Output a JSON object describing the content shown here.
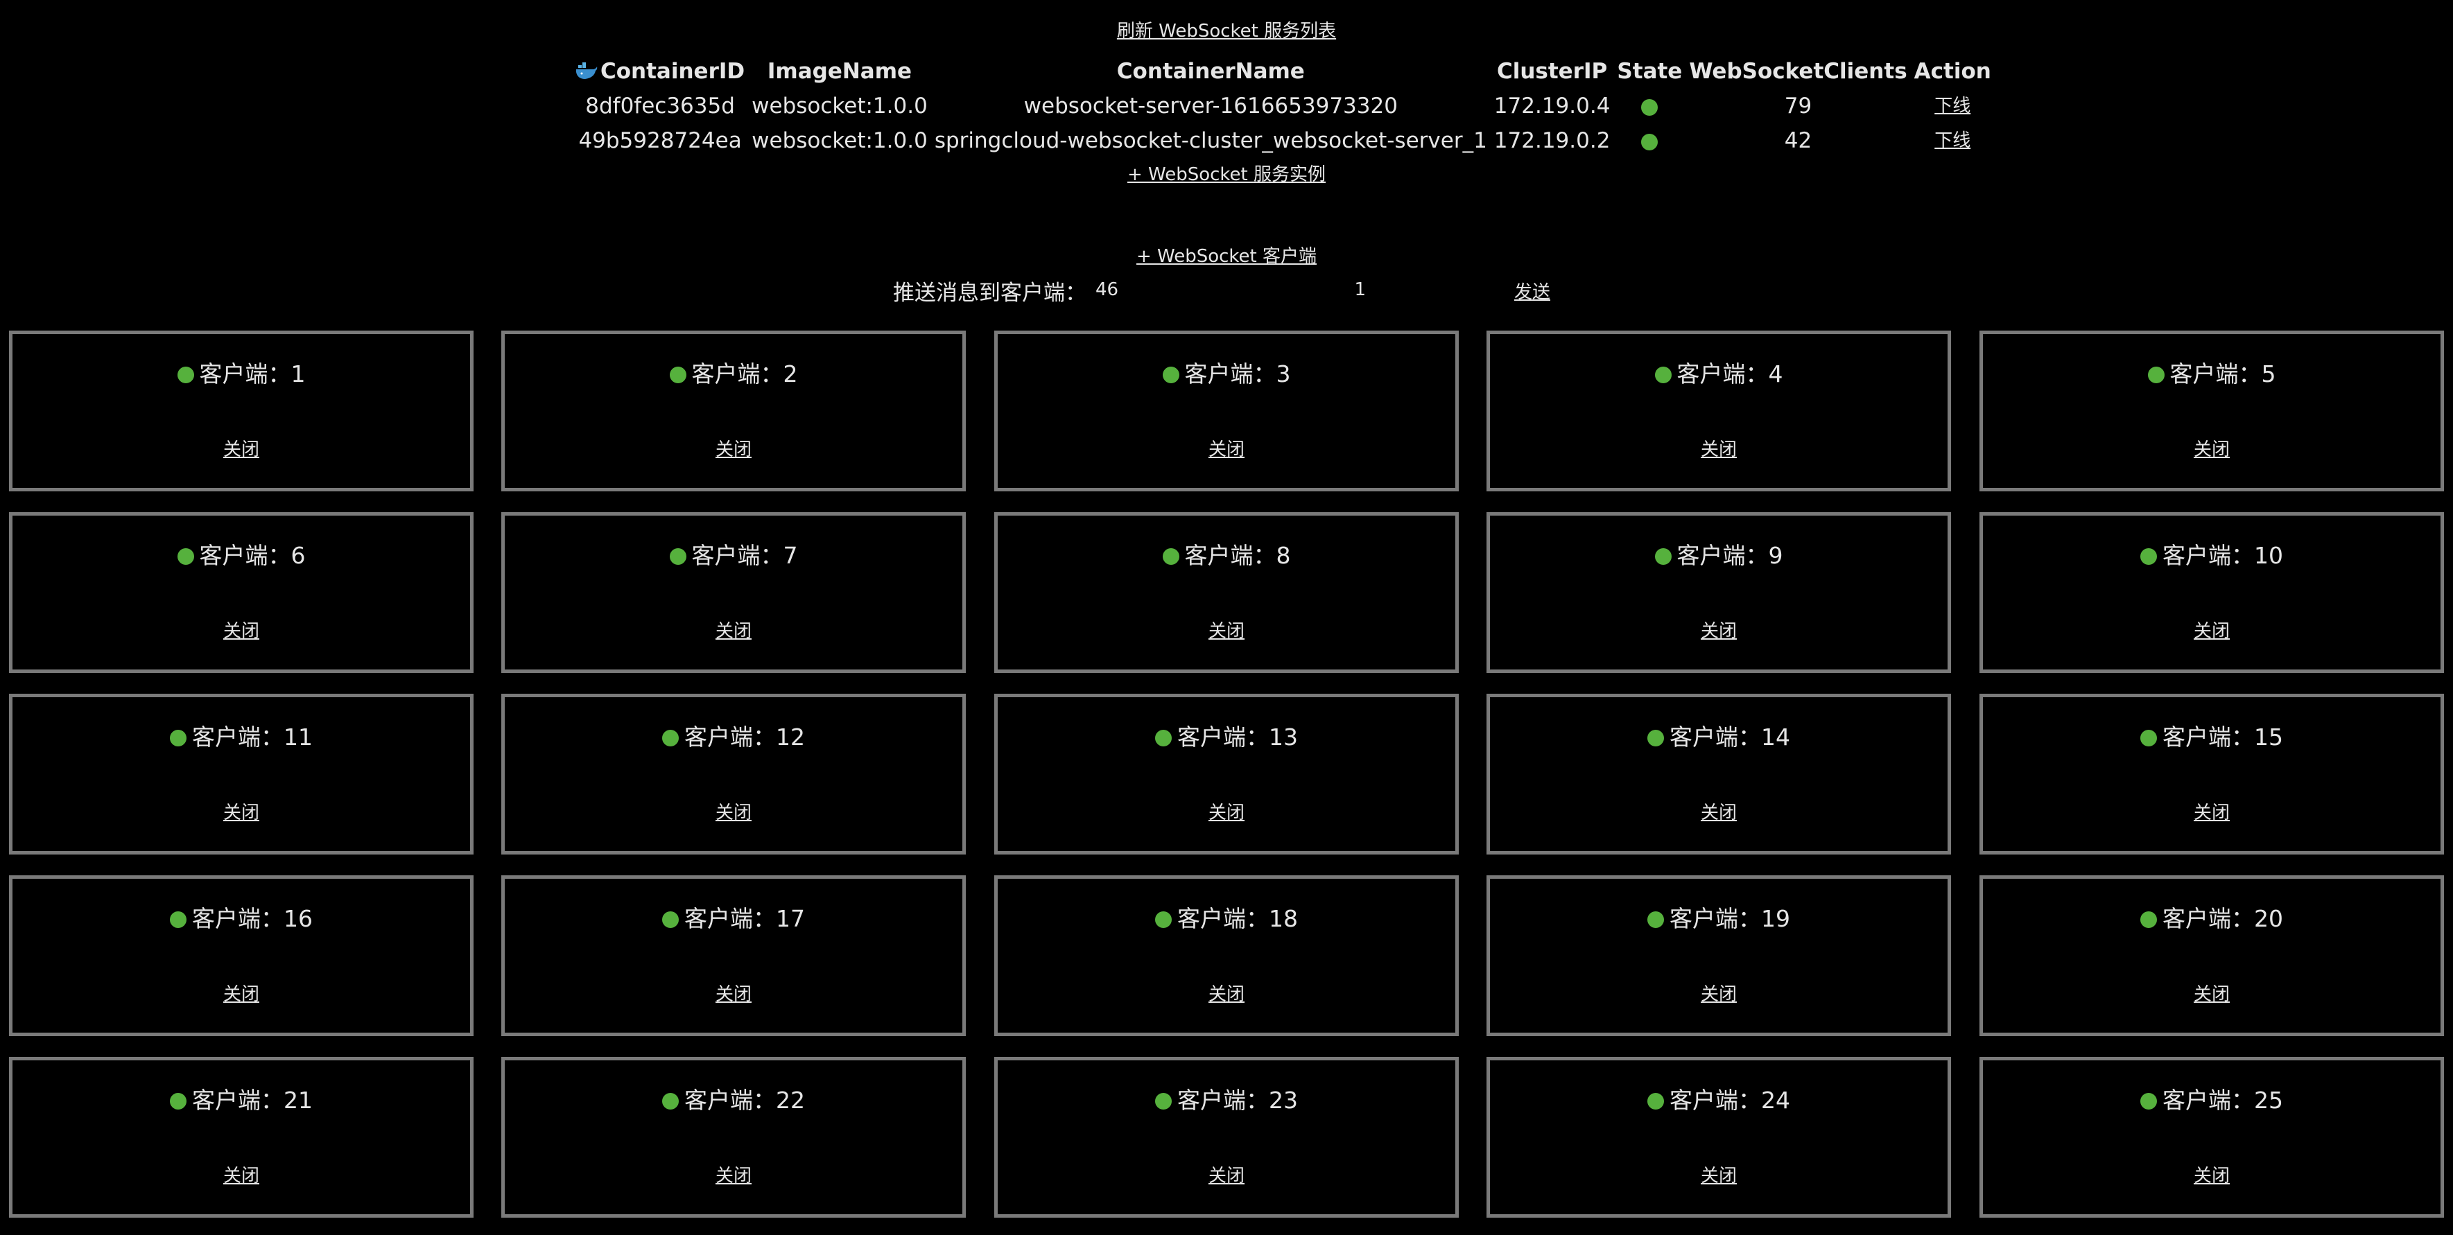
{
  "header": {
    "refresh_link": "刷新 WebSocket 服务列表",
    "add_instance_link": "+ WebSocket 服务实例",
    "add_client_link": "+ WebSocket 客户端"
  },
  "services": {
    "columns": [
      "ContainerID",
      "ImageName",
      "ContainerName",
      "ClusterIP",
      "State",
      "WebSocketClients",
      "Action"
    ],
    "rows": [
      {
        "container_id": "8df0fec3635d",
        "image_name": "websocket:1.0.0",
        "container_name": "websocket-server-1616653973320",
        "cluster_ip": "172.19.0.4",
        "state_color": "#56b13d",
        "clients": "79",
        "action": "下线"
      },
      {
        "container_id": "49b5928724ea",
        "image_name": "websocket:1.0.0",
        "container_name": "springcloud-websocket-cluster_websocket-server_1",
        "cluster_ip": "172.19.0.2",
        "state_color": "#56b13d",
        "clients": "42",
        "action": "下线"
      }
    ]
  },
  "push": {
    "label": "推送消息到客户端：",
    "client_value": "46",
    "message_value": "1",
    "send_label": "发送"
  },
  "client_title_prefix": "客户端：",
  "client_close_label": "关闭",
  "clients": [
    {
      "number": "1",
      "title": "客户端：1"
    },
    {
      "number": "2",
      "title": "客户端：2"
    },
    {
      "number": "3",
      "title": "客户端：3"
    },
    {
      "number": "4",
      "title": "客户端：4"
    },
    {
      "number": "5",
      "title": "客户端：5"
    },
    {
      "number": "6",
      "title": "客户端：6"
    },
    {
      "number": "7",
      "title": "客户端：7"
    },
    {
      "number": "8",
      "title": "客户端：8"
    },
    {
      "number": "9",
      "title": "客户端：9"
    },
    {
      "number": "10",
      "title": "客户端：10"
    },
    {
      "number": "11",
      "title": "客户端：11"
    },
    {
      "number": "12",
      "title": "客户端：12"
    },
    {
      "number": "13",
      "title": "客户端：13"
    },
    {
      "number": "14",
      "title": "客户端：14"
    },
    {
      "number": "15",
      "title": "客户端：15"
    },
    {
      "number": "16",
      "title": "客户端：16"
    },
    {
      "number": "17",
      "title": "客户端：17"
    },
    {
      "number": "18",
      "title": "客户端：18"
    },
    {
      "number": "19",
      "title": "客户端：19"
    },
    {
      "number": "20",
      "title": "客户端：20"
    },
    {
      "number": "21",
      "title": "客户端：21"
    },
    {
      "number": "22",
      "title": "客户端：22"
    },
    {
      "number": "23",
      "title": "客户端：23"
    },
    {
      "number": "24",
      "title": "客户端：24"
    },
    {
      "number": "25",
      "title": "客户端：25"
    }
  ],
  "colors": {
    "status_green": "#56b13d",
    "card_border": "#7a7a7a",
    "background": "#000000",
    "text": "#e6e6e6"
  },
  "icons": {
    "container_id_header": "docker-whale-icon",
    "state": "status-dot-icon"
  }
}
